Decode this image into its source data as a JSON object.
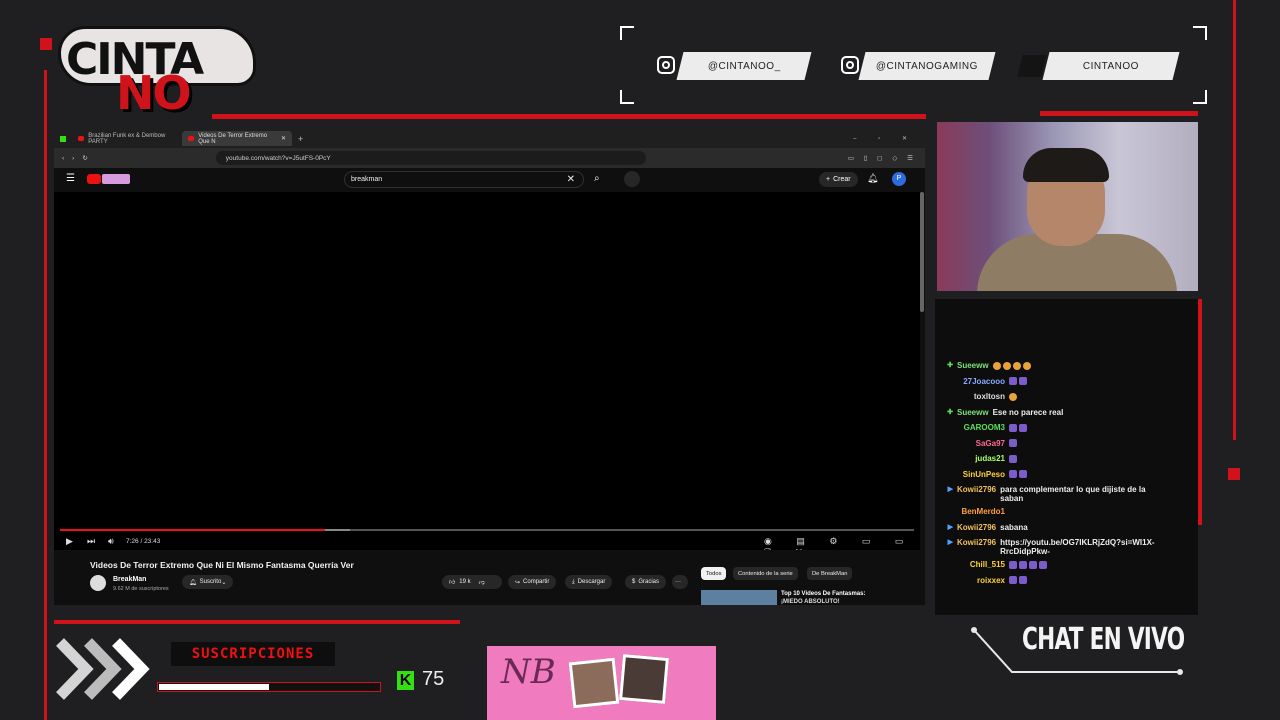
{
  "overlay": {
    "logo_line1": "CINTA",
    "logo_line2": "NO",
    "socials": [
      {
        "icon": "instagram-icon",
        "handle": "@CINTANOO_"
      },
      {
        "icon": "instagram-icon",
        "handle": "@CINTANOGAMING"
      },
      {
        "icon": "kick-icon",
        "handle": "CINTANOO"
      }
    ],
    "subscriptions_label": "SUSCRIPCIONES",
    "subscriptions_progress": 0.5,
    "kick_logo": "K",
    "kick_count": "75",
    "chat_title": "CHAT EN VIVO",
    "accent_color": "#d0121b"
  },
  "browser": {
    "tabs": [
      {
        "label": "Brazilian Funk ex & Dembow PARTY"
      },
      {
        "label": "Videos De Terror Extremo Que N"
      }
    ],
    "new_tab": "+",
    "url": "youtube.com/watch?v=J5utFS-0PcY"
  },
  "youtube": {
    "search_value": "breakman",
    "create_label": "Crear",
    "avatar_letter": "P",
    "time_display": "7:26 / 23:43",
    "progress": 0.31,
    "buffered": 0.34,
    "video_title": "Videos De Terror Extremo Que Ni El Mismo Fantasma Querría Ver",
    "channel": "BreakMan",
    "subscribers": "9.62 M de suscriptores",
    "subscribed_label": "Suscrito",
    "likes": "19 k",
    "share_label": "Compartir",
    "download_label": "Descargar",
    "thanks_label": "Gracias",
    "more_label": "···",
    "chips": [
      "Todos",
      "Contenido de la serie",
      "De BreakMan"
    ],
    "rec_title_1": "Top 10 Videos De Fantasmas:",
    "rec_title_2": "¡MIEDO ABSOLUTO!"
  },
  "chat": [
    {
      "name": "Sueeww",
      "color": "#7be07b",
      "sub": true,
      "text": "",
      "emotes": 4,
      "badges": 0
    },
    {
      "name": "27Joacooo",
      "color": "#8aa9ff",
      "sub": false,
      "text": "",
      "emotes": 0,
      "badges": 2
    },
    {
      "name": "toxltosn",
      "color": "#dddddd",
      "sub": false,
      "text": "",
      "emotes": 1,
      "badges": 0
    },
    {
      "name": "Sueeww",
      "color": "#7be07b",
      "sub": true,
      "text": "Ese no parece real",
      "emotes": 0,
      "badges": 0
    },
    {
      "name": "GAROOM3",
      "color": "#5be05b",
      "sub": false,
      "text": "",
      "emotes": 0,
      "badges": 2
    },
    {
      "name": "SaGa97",
      "color": "#ff6b8b",
      "sub": false,
      "text": "",
      "emotes": 0,
      "badges": 1
    },
    {
      "name": "judas21",
      "color": "#a8ff6a",
      "sub": false,
      "text": "",
      "emotes": 0,
      "badges": 1
    },
    {
      "name": "SinUnPeso",
      "color": "#ffd23b",
      "sub": false,
      "text": "",
      "emotes": 0,
      "badges": 2
    },
    {
      "name": "Kowii2796",
      "color": "#f0c060",
      "sub": false,
      "text": "para complementar lo que dijiste de la saban",
      "emotes": 0,
      "badges": 0
    },
    {
      "name": "BenMerdo1",
      "color": "#ff9f3b",
      "sub": false,
      "text": "",
      "emotes": 0,
      "badges": 0
    },
    {
      "name": "Kowii2796",
      "color": "#f0c060",
      "sub": false,
      "text": "sabana",
      "emotes": 0,
      "badges": 0
    },
    {
      "name": "Kowii2796",
      "color": "#f0c060",
      "sub": false,
      "text": "https://youtu.be/OG7IKLRjZdQ?si=WI1X-RrcDidpPkw-",
      "emotes": 0,
      "badges": 0
    },
    {
      "name": "Chill_515",
      "color": "#ffd23b",
      "sub": false,
      "text": "",
      "emotes": 0,
      "badges": 4
    },
    {
      "name": "roixxex",
      "color": "#ffd23b",
      "sub": false,
      "text": "",
      "emotes": 0,
      "badges": 2
    }
  ]
}
